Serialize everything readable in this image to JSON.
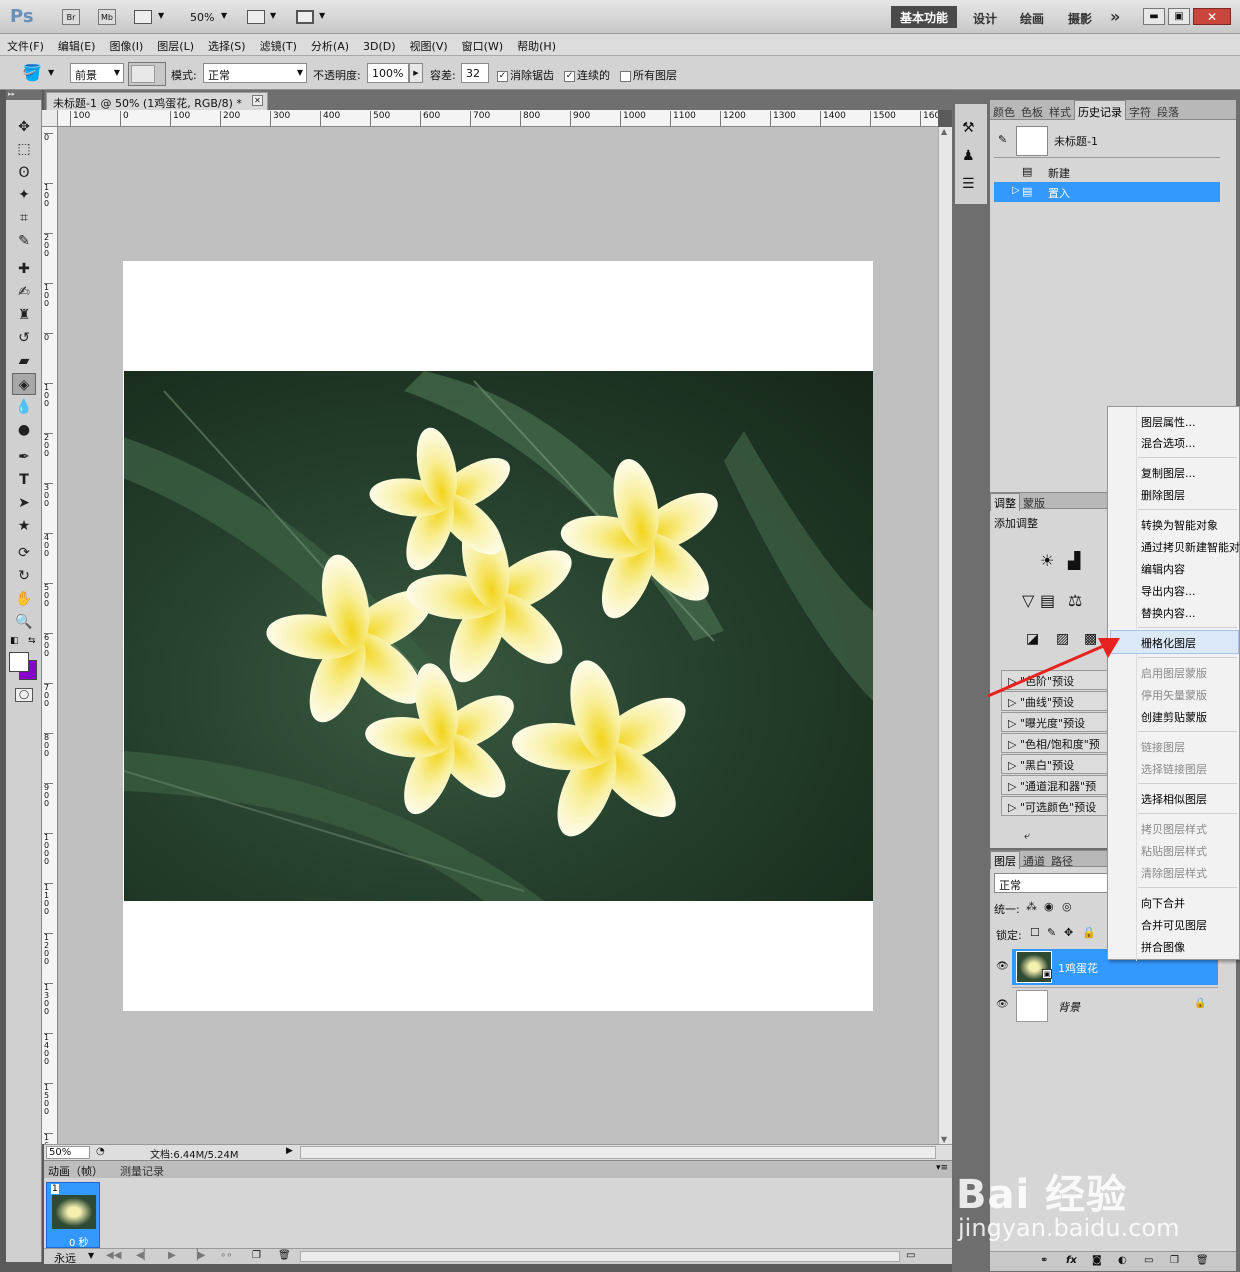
{
  "titlebar": {
    "app_logo": "Ps",
    "bridge": "Br",
    "minibridge": "Mb",
    "zoom": "50%",
    "workspaces": [
      "基本功能",
      "设计",
      "绘画",
      "摄影"
    ],
    "more": "»"
  },
  "menu": [
    "文件(F)",
    "编辑(E)",
    "图像(I)",
    "图层(L)",
    "选择(S)",
    "滤镜(T)",
    "分析(A)",
    "3D(D)",
    "视图(V)",
    "窗口(W)",
    "帮助(H)"
  ],
  "options": {
    "fill_source": "前景",
    "mode_label": "模式:",
    "mode_value": "正常",
    "opacity_label": "不透明度:",
    "opacity_value": "100%",
    "tolerance_label": "容差:",
    "tolerance_value": "32",
    "antialias_label": "消除锯齿",
    "contiguous_label": "连续的",
    "all_layers_label": "所有图层"
  },
  "document": {
    "tab_title": "未标题-1 @ 50% (1鸡蛋花, RGB/8) *",
    "ruler_top": [
      "100",
      "0",
      "100",
      "200",
      "300",
      "400",
      "500",
      "600",
      "700",
      "800",
      "900",
      "1000",
      "1100",
      "1200",
      "1300",
      "1400",
      "1500",
      "160"
    ],
    "ruler_left": [
      "0",
      "1 0 0",
      "2 0 0",
      "1 0 0",
      "0",
      "1 0 0",
      "2 0 0",
      "3 0 0",
      "4 0 0",
      "5 0 0",
      "6 0 0",
      "7 0 0",
      "8 0 0",
      "9 0 0",
      "1 0 0 0",
      "1 1 0 0",
      "1 2 0 0",
      "1 3 0 0",
      "1 4 0 0",
      "1 5 0 0",
      "1 6 0 0",
      "1 7 0 0"
    ]
  },
  "status": {
    "zoom": "50%",
    "doc_size": "文档:6.44M/5.24M"
  },
  "animation": {
    "tabs": [
      "动画（帧）",
      "测量记录"
    ],
    "frame_number": "1",
    "frame_delay": "0 秒",
    "loop": "永远"
  },
  "history": {
    "tabs": [
      "颜色",
      "色板",
      "样式",
      "历史记录",
      "字符",
      "段落"
    ],
    "snapshot": "未标题-1",
    "items": [
      "新建",
      "置入"
    ]
  },
  "adjustments": {
    "tabs": [
      "调整",
      "蒙版"
    ],
    "add_label": "添加调整",
    "presets": [
      "\"色阶\"预设",
      "\"曲线\"预设",
      "\"曝光度\"预设",
      "\"色相/饱和度\"预",
      "\"黑白\"预设",
      "\"通道混和器\"预",
      "\"可选颜色\"预设"
    ]
  },
  "layers": {
    "tabs": [
      "图层",
      "通道",
      "路径"
    ],
    "blend_mode": "正常",
    "unify_label": "统一:",
    "lock_label": "锁定:",
    "items": [
      "1鸡蛋花",
      "背景"
    ]
  },
  "context_menu": {
    "items": [
      {
        "label": "图层属性...",
        "disabled": false
      },
      {
        "label": "混合选项...",
        "disabled": false
      },
      {
        "label": "复制图层...",
        "disabled": false
      },
      {
        "label": "删除图层",
        "disabled": false
      },
      {
        "label": "转换为智能对象",
        "disabled": false
      },
      {
        "label": "通过拷贝新建智能对",
        "disabled": false
      },
      {
        "label": "编辑内容",
        "disabled": false
      },
      {
        "label": "导出内容...",
        "disabled": false
      },
      {
        "label": "替换内容...",
        "disabled": false
      },
      {
        "label": "栅格化图层",
        "disabled": false
      },
      {
        "label": "启用图层蒙版",
        "disabled": true
      },
      {
        "label": "停用矢量蒙版",
        "disabled": true
      },
      {
        "label": "创建剪贴蒙版",
        "disabled": false
      },
      {
        "label": "链接图层",
        "disabled": true
      },
      {
        "label": "选择链接图层",
        "disabled": true
      },
      {
        "label": "选择相似图层",
        "disabled": false
      },
      {
        "label": "拷贝图层样式",
        "disabled": true
      },
      {
        "label": "粘贴图层样式",
        "disabled": true
      },
      {
        "label": "清除图层样式",
        "disabled": true
      },
      {
        "label": "向下合并",
        "disabled": false
      },
      {
        "label": "合并可见图层",
        "disabled": false
      },
      {
        "label": "拼合图像",
        "disabled": false
      }
    ]
  },
  "watermark": {
    "brand": "Bai 经验",
    "url": "jingyan.baidu.com"
  },
  "colors": {
    "accent": "#3399ff",
    "fg_swatch": "#ffffff",
    "bg_swatch": "#8800cc",
    "arrow": "#e8231f"
  }
}
